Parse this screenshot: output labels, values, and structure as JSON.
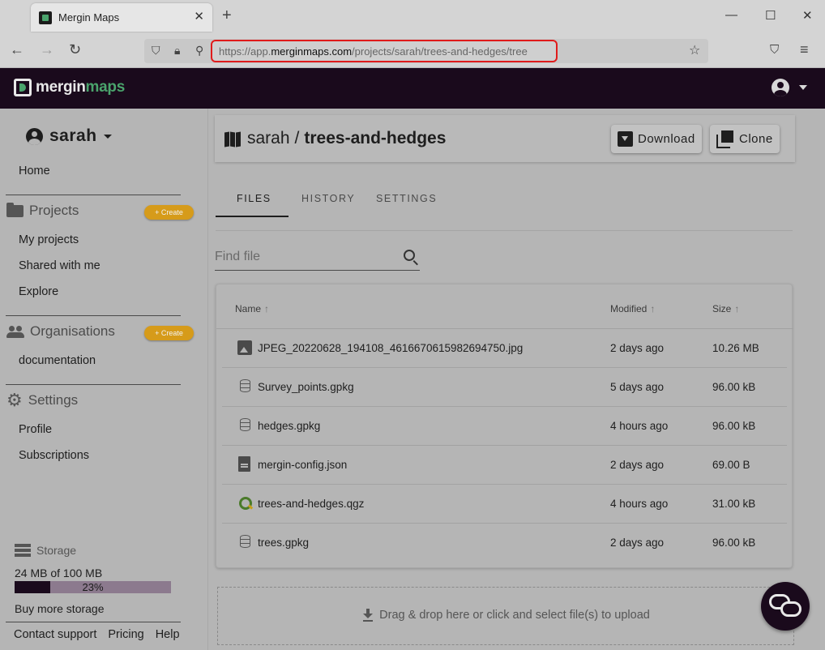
{
  "browser": {
    "tab_title": "Mergin Maps",
    "url_scheme": "https://app.",
    "url_domain": "merginmaps.com",
    "url_path": "/projects/sarah/trees-and-hedges/tree"
  },
  "header": {
    "logo_main": "mergin",
    "logo_accent": "maps"
  },
  "sidebar": {
    "username": "sarah",
    "home": "Home",
    "projects_title": "Projects",
    "projects_create": "+ Create",
    "projects_items": [
      "My projects",
      "Shared with me",
      "Explore"
    ],
    "orgs_title": "Organisations",
    "orgs_create": "+ Create",
    "orgs_items": [
      "documentation"
    ],
    "settings_title": "Settings",
    "settings_items": [
      "Profile",
      "Subscriptions"
    ],
    "storage_title": "Storage",
    "storage_used": "24 MB of 100 MB",
    "storage_fraction": 0.23,
    "storage_pct_label": "23%",
    "buy_storage": "Buy more storage",
    "footer": [
      "Contact support",
      "Pricing",
      "Help"
    ]
  },
  "project": {
    "owner": "sarah",
    "separator": "/",
    "name": "trees-and-hedges",
    "download_label": "Download",
    "clone_label": "Clone"
  },
  "tabs": [
    "FILES",
    "HISTORY",
    "SETTINGS"
  ],
  "search": {
    "placeholder": "Find file"
  },
  "table": {
    "headers": {
      "name": "Name",
      "modified": "Modified",
      "size": "Size"
    },
    "rows": [
      {
        "icon": "image-icon",
        "name": "JPEG_20220628_194108_4616670615982694750.jpg",
        "modified": "2 days ago",
        "size": "10.26 MB"
      },
      {
        "icon": "database-icon",
        "name": "Survey_points.gpkg",
        "modified": "5 days ago",
        "size": "96.00 kB"
      },
      {
        "icon": "database-icon",
        "name": "hedges.gpkg",
        "modified": "4 hours ago",
        "size": "96.00 kB"
      },
      {
        "icon": "document-icon",
        "name": "mergin-config.json",
        "modified": "2 days ago",
        "size": "69.00 B"
      },
      {
        "icon": "qgis-icon",
        "name": "trees-and-hedges.qgz",
        "modified": "4 hours ago",
        "size": "31.00 kB"
      },
      {
        "icon": "database-icon",
        "name": "trees.gpkg",
        "modified": "2 days ago",
        "size": "96.00 kB"
      }
    ]
  },
  "upload": {
    "label": "Drag & drop here or click and select file(s) to upload"
  },
  "colors": {
    "header_bg": "#1a0a1c",
    "accent_green": "#4aa36c",
    "create_badge": "#d69b1a",
    "url_highlight": "#e01b1b"
  }
}
